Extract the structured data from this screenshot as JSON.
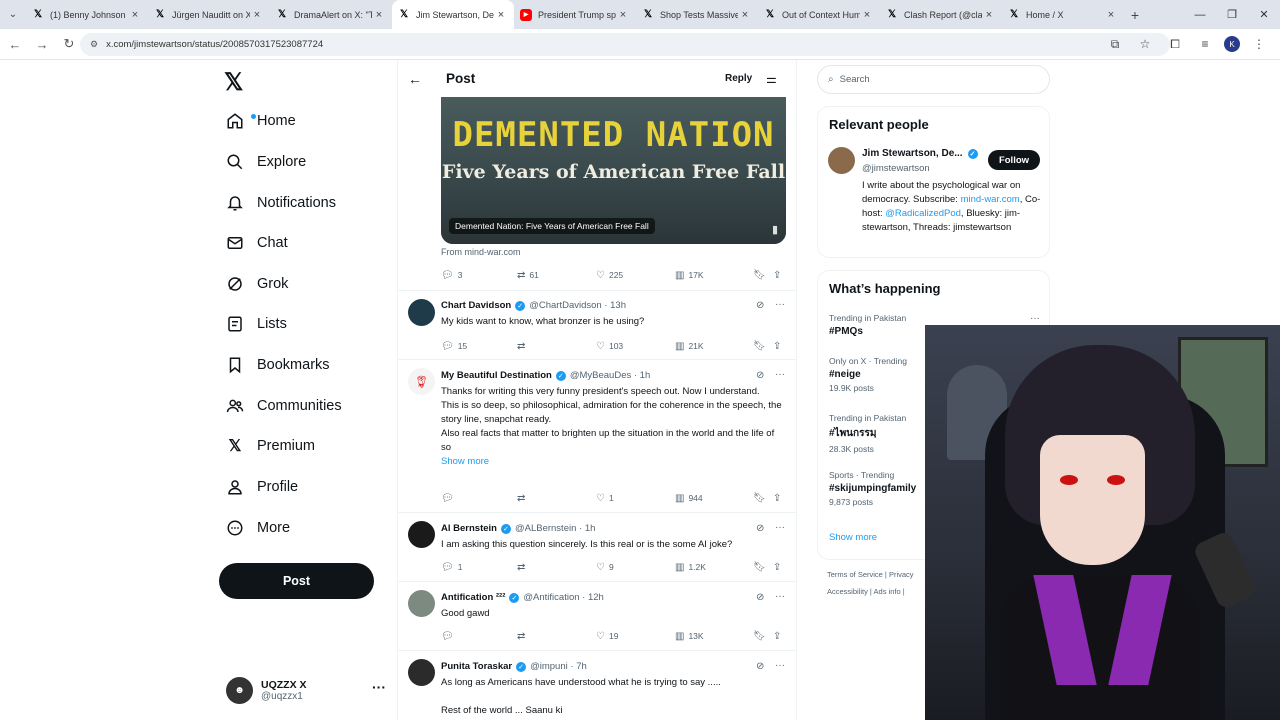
{
  "browser": {
    "tabs": [
      {
        "icon": "X",
        "title": "(1) Benny Johnson on X",
        "active": false
      },
      {
        "icon": "X",
        "title": "Jürgen Nauditt  on X",
        "active": false
      },
      {
        "icon": "X",
        "title": "DramaAlert on X: \"The",
        "active": false
      },
      {
        "icon": "X",
        "title": "Jim Stewartson, Decr",
        "active": true
      },
      {
        "icon": "yt",
        "title": "President Trump spe",
        "active": false
      },
      {
        "icon": "X",
        "title": "Shop Tests Massive T",
        "active": false
      },
      {
        "icon": "X",
        "title": "Out of Context Huma",
        "active": false
      },
      {
        "icon": "X",
        "title": "Clash Report (@clash",
        "active": false
      },
      {
        "icon": "X",
        "title": "Home / X",
        "active": false
      }
    ],
    "url": "x.com/jimstewartson/status/2008570317523087724",
    "profile_initial": "K"
  },
  "leftnav": {
    "items": [
      {
        "label": "Home",
        "icon": "home-icon"
      },
      {
        "label": "Explore",
        "icon": "search-icon"
      },
      {
        "label": "Notifications",
        "icon": "bell-icon"
      },
      {
        "label": "Chat",
        "icon": "mail-icon"
      },
      {
        "label": "Grok",
        "icon": "grok-icon"
      },
      {
        "label": "Lists",
        "icon": "list-icon"
      },
      {
        "label": "Bookmarks",
        "icon": "bookmark-icon"
      },
      {
        "label": "Communities",
        "icon": "people-icon"
      },
      {
        "label": "Premium",
        "icon": "x-icon"
      },
      {
        "label": "Profile",
        "icon": "person-icon"
      },
      {
        "label": "More",
        "icon": "more-circle-icon"
      }
    ],
    "post_label": "Post",
    "account": {
      "name": "UQZZX X",
      "handle": "@uqzzx1"
    }
  },
  "header": {
    "title": "Post",
    "reply_label": "Reply"
  },
  "main_post": {
    "card_title": "DEMENTED NATION",
    "card_subtitle": "Five Years of American Free Fall",
    "card_caption": "Demented Nation: Five Years of American Free Fall",
    "source": "From mind-war.com",
    "stats": {
      "replies": "3",
      "reposts": "61",
      "likes": "225",
      "views": "17K"
    }
  },
  "replies": [
    {
      "name": "Chart Davidson",
      "handle": "@ChartDavidson",
      "time": "· 13h",
      "text": "My kids want to know, what bronzer is he using?",
      "replies": "15",
      "reposts": "",
      "likes": "103",
      "views": "21K",
      "avatar_color": "#1f3b4a"
    },
    {
      "name": "My Beautiful Destination",
      "handle": "@MyBeauDes",
      "time": "· 1h",
      "text1": "Thanks for writing this very funny president's speech out. Now I understand.",
      "text2": "This is so deep, so philosophical, admiration for the coherence in the speech, the story line, snapchat ready.",
      "text3": "Also real facts that matter to brighten up the situation in the world and the life of so",
      "show_more": "Show more",
      "replies": "",
      "reposts": "",
      "likes": "1",
      "views": "944",
      "avatar_color": "#f4f4f4"
    },
    {
      "name": "Al Bernstein",
      "handle": "@ALBernstein",
      "time": "· 1h",
      "text": "I am asking this question sincerely. Is this real or is the some AI joke?",
      "replies": "1",
      "reposts": "",
      "likes": "9",
      "views": "1.2K",
      "avatar_color": "#1a1a1a"
    },
    {
      "name": "Antification ²²²",
      "handle": "@Antification",
      "time": "· 12h",
      "text": "Good gawd",
      "replies": "",
      "reposts": "",
      "likes": "19",
      "views": "13K",
      "avatar_color": "#7d8a80"
    },
    {
      "name": "Punita Toraskar",
      "handle": "@impuni",
      "time": "· 7h",
      "text1": "As long as Americans have understood what he is trying to say .....",
      "text2": "Rest of the world ... Saanu ki",
      "avatar_color": "#2b2b2b"
    }
  ],
  "right": {
    "search_placeholder": "Search",
    "relevant_title": "Relevant people",
    "person": {
      "name": "Jim Stewartson, De...",
      "handle": "@jimstewartson",
      "follow_label": "Follow",
      "bio_1": "I write about the psychological war on democracy. Subscribe: ",
      "bio_link1": "mind-war.com",
      "bio_2": ", Co-host: ",
      "bio_link2": "@RadicalizedPod",
      "bio_3": ", Bluesky: jim-stewartson, Threads: jimstewartson"
    },
    "happening_title": "What’s happening",
    "trends": [
      {
        "meta": "Trending in Pakistan",
        "tag": "#PMQs",
        "count": ""
      },
      {
        "meta": "Only on X · Trending",
        "tag": "#neige",
        "count": "19.9K posts"
      },
      {
        "meta": "Trending in Pakistan",
        "tag": "#ไพนกรรมฺ",
        "count": "28.3K posts"
      },
      {
        "meta": "Sports · Trending",
        "tag": "#skijumpingfamily",
        "count": "9,873 posts"
      }
    ],
    "show_more": "Show more",
    "footer_1": "Terms of Service  |  Privacy",
    "footer_2": "Accessibility  |  Ads info  |"
  }
}
